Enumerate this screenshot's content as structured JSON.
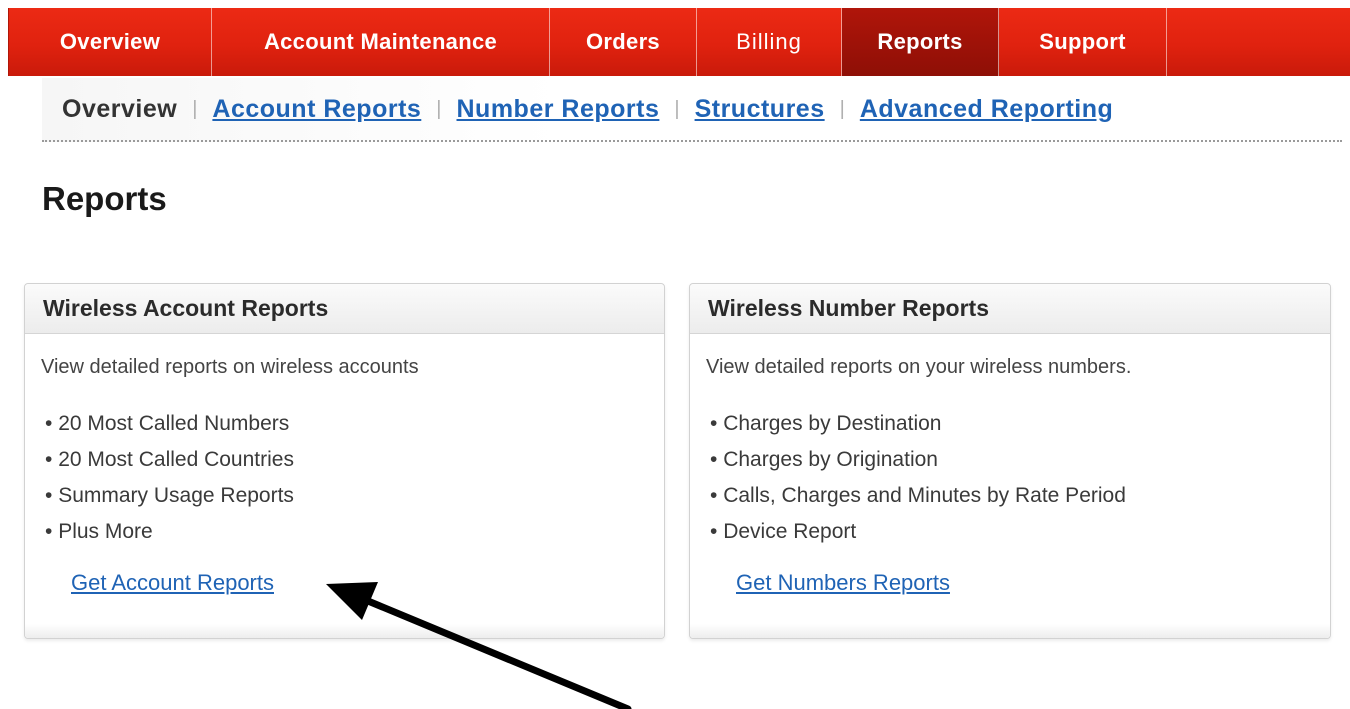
{
  "top_nav": {
    "tabs": [
      {
        "label": "Overview",
        "active": false
      },
      {
        "label": "Account Maintenance",
        "active": false
      },
      {
        "label": "Orders",
        "active": false
      },
      {
        "label": "Billing",
        "active": false
      },
      {
        "label": "Reports",
        "active": true
      },
      {
        "label": "Support",
        "active": false
      }
    ]
  },
  "sub_nav": {
    "current": "Overview",
    "links": [
      "Account Reports",
      "Number Reports",
      "Structures",
      "Advanced Reporting"
    ]
  },
  "page": {
    "title": "Reports"
  },
  "panels": {
    "account": {
      "title": "Wireless Account Reports",
      "description": "View detailed reports on wireless accounts",
      "items": [
        "20 Most Called Numbers",
        "20 Most Called Countries",
        "Summary Usage Reports",
        "Plus More"
      ],
      "link": "Get Account Reports"
    },
    "number": {
      "title": "Wireless Number Reports",
      "description": "View detailed reports on your wireless numbers.",
      "items": [
        "Charges by Destination",
        "Charges by Origination",
        "Calls, Charges and Minutes by Rate Period",
        "Device Report"
      ],
      "link": "Get Numbers Reports"
    }
  },
  "colors": {
    "nav_red": "#e0220f",
    "nav_active": "#9a1208",
    "link_blue": "#1f63b5",
    "title_text": "#1a1a1a"
  }
}
